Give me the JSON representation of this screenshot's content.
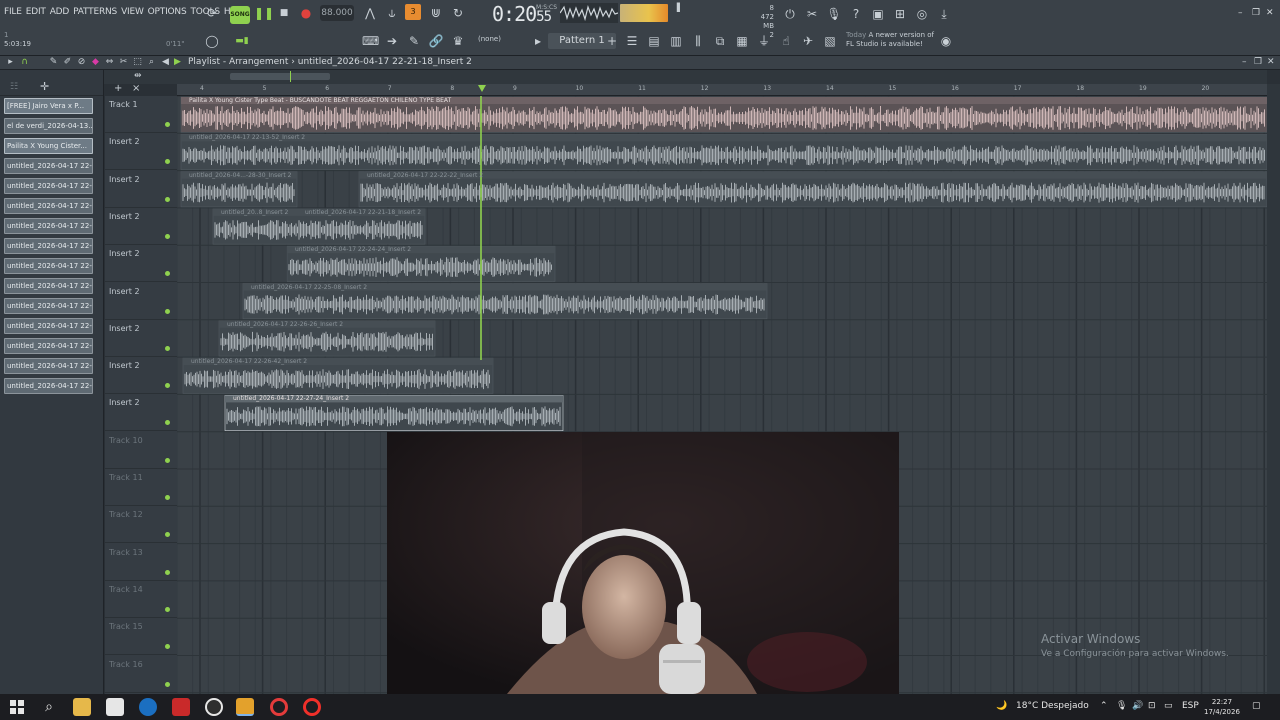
{
  "menu": [
    "FILE",
    "EDIT",
    "ADD",
    "PATTERNS",
    "VIEW",
    "OPTIONS",
    "TOOLS",
    "HELP"
  ],
  "transport": {
    "mode_label": "SONG",
    "tempo": "88.000",
    "time": "0:20",
    "time_sub": "55",
    "time_ms_label": "M:S:CS"
  },
  "system_meter": {
    "cpu": "8",
    "mem": "472 MB",
    "voices": "2"
  },
  "pattern": {
    "selected": "Pattern 1",
    "channel_filter": "(none)"
  },
  "update_hint": {
    "when": "Today",
    "line1": "A newer version of",
    "line2": "FL Studio is available!"
  },
  "readouts": {
    "position": "5:03:19",
    "small": "0'11\"",
    "top_small": "1"
  },
  "playlist": {
    "title": "Playlist - Arrangement",
    "separator": "›",
    "current_clip": "untitled_2026-04-17 22-21-18_Insert 2",
    "bar_numbers": [
      "4",
      "5",
      "6",
      "7",
      "8",
      "9",
      "10",
      "11",
      "12",
      "13",
      "14",
      "15",
      "16",
      "17",
      "18",
      "19",
      "20"
    ]
  },
  "picker_items": [
    "[FREE] Jairo Vera x P...",
    "el de verdi_2026-04-13...",
    "Pailita X Young Cister...",
    "untitled_2026-04-17 22-...",
    "untitled_2026-04-17 22-...",
    "untitled_2026-04-17 22-...",
    "untitled_2026-04-17 22-...",
    "untitled_2026-04-17 22-...",
    "untitled_2026-04-17 22-...",
    "untitled_2026-04-17 22-...",
    "untitled_2026-04-17 22-...",
    "untitled_2026-04-17 22-...",
    "untitled_2026-04-17 22-...",
    "untitled_2026-04-17 22-...",
    "untitled_2026-04-17 22-..."
  ],
  "tracks": [
    "Track 1",
    "Insert 2",
    "Insert 2",
    "Insert 2",
    "Insert 2",
    "Insert 2",
    "Insert 2",
    "Insert 2",
    "Insert 2",
    "Track 10",
    "Track 11",
    "Track 12",
    "Track 13",
    "Track 14",
    "Track 15",
    "Track 16"
  ],
  "clip_labels": [
    "Pailita X Young Cister Type Beat - BUSCANDOTE  BEAT REGGAETON CHILENO TYPE BEAT",
    "untitled_2026-04-17 22-13-52_Insert 2",
    "untitled_2026-04...-28-30_Insert 2",
    "untitled_2026-04-17 22-22-22_Insert 2",
    "untitled_20..8_Insert 2",
    "untitled_2026-04-17 22-21-18_Insert 2",
    "untitled_2026-04-17 22-24-24_Insert 2",
    "untitled_2026-04-17 22-25-08_Insert 2",
    "untitled_2026-04-17 22-26-26_Insert 2",
    "untitled_2026-04-17 22-26-42_Insert 2",
    "untitled_2026-04-17 22-27-24_Insert 2"
  ],
  "watermark": {
    "line1": "Activar Windows",
    "line2": "Ve a Configuración para activar Windows."
  },
  "tray": {
    "weather": "18°C  Despejado",
    "lang": "ESP",
    "time": "22:27",
    "date": "17/4/2026"
  },
  "colors": {
    "accent_green": "#8fd14f",
    "track1_wave": "#e4c9c9",
    "clip_wave": "#b9c0c5",
    "playhead": "#8fd14f"
  }
}
